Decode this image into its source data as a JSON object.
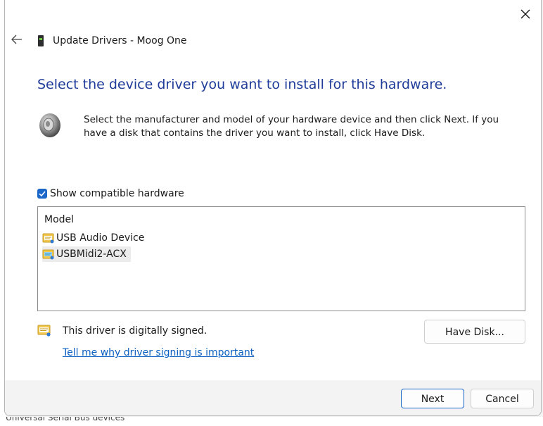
{
  "window": {
    "close_icon": "close-icon",
    "back_icon": "back-arrow-icon",
    "title": "Update Drivers - Moog One"
  },
  "heading": "Select the device driver you want to install for this hardware.",
  "instructions": "Select the manufacturer and model of your hardware device and then click Next. If you have a disk that contains the driver you want to install, click Have Disk.",
  "compatible": {
    "label": "Show compatible hardware",
    "checked": true
  },
  "model_list": {
    "header": "Model",
    "items": [
      {
        "label": "USB Audio Device",
        "selected": false
      },
      {
        "label": "USBMidi2-ACX",
        "selected": true
      }
    ]
  },
  "signing": {
    "status": "This driver is digitally signed.",
    "link": "Tell me why driver signing is important"
  },
  "buttons": {
    "have_disk": "Have Disk...",
    "next": "Next",
    "cancel": "Cancel"
  },
  "background": {
    "bottom_text": "Universal Serial Bus devices"
  },
  "colors": {
    "accent": "#1a67c9",
    "heading": "#1f3c99",
    "link": "#0b5fc0"
  }
}
